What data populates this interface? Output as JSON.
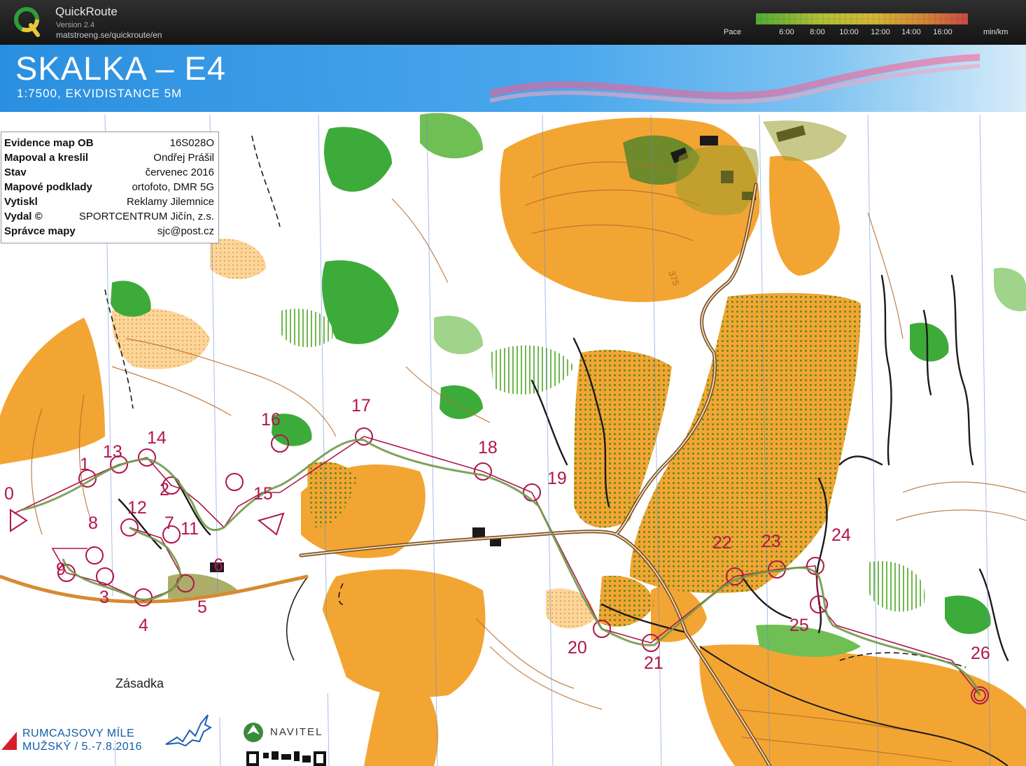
{
  "app": {
    "name": "QuickRoute",
    "version": "Version 2.4",
    "url": "matstroeng.se/quickroute/en"
  },
  "pace_scale": {
    "label": "Pace",
    "ticks": [
      "6:00",
      "8:00",
      "10:00",
      "12:00",
      "14:00",
      "16:00"
    ],
    "unit": "min/km",
    "colors": [
      "#59c23a",
      "#c8dc3a",
      "#f2d23a",
      "#f2953a",
      "#e8504a"
    ]
  },
  "map": {
    "title": "SKALKA – E4",
    "subtitle": "1:7500, EKVIDISTANCE 5M",
    "contour_label": "375",
    "place_name": "Zásadka",
    "legend": [
      {
        "key": "Evidence map OB",
        "value": "16S028O"
      },
      {
        "key": "Mapoval a kreslil",
        "value": "Ondřej Prášil"
      },
      {
        "key": "Stav",
        "value": "červenec 2016"
      },
      {
        "key": "Mapové podklady",
        "value": "ortofoto, DMR 5G"
      },
      {
        "key": "Vytiskl",
        "value": "Reklamy Jilemnice"
      },
      {
        "key": "Vydal ©",
        "value": "SPORTCENTRUM Jičín, z.s."
      },
      {
        "key": "Správce mapy",
        "value": "sjc@post.cz"
      }
    ],
    "controls": [
      "0",
      "1",
      "2",
      "3",
      "4",
      "5",
      "6",
      "7",
      "8",
      "9",
      "11",
      "12",
      "13",
      "14",
      "15",
      "16",
      "17",
      "18",
      "19",
      "20",
      "21",
      "22",
      "23",
      "24",
      "25",
      "26"
    ],
    "colors": {
      "open_land": "#f3a533",
      "rough_open": "#fbd59a",
      "forest_green": "#3dab3a",
      "light_green": "#9fd48a",
      "contour": "#b86a2a",
      "course": "#b0164a",
      "route": "#6f9a4a",
      "road": "#a07040",
      "water_banner": "#3f9ee8"
    }
  },
  "footer": {
    "event_line1": "RUMCAJSOVY MÍLE",
    "event_line2": "MUŽSKÝ / 5.-7.8.2016",
    "sponsor": "NAVITEL"
  }
}
